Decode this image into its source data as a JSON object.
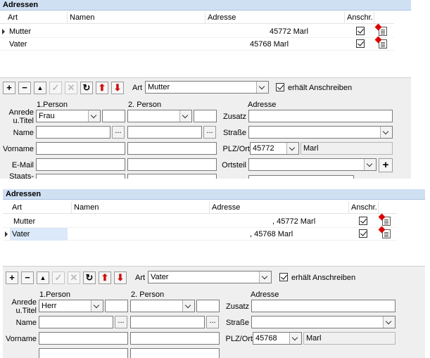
{
  "panel1": {
    "title": "Adressen",
    "columns": [
      "Art",
      "Namen",
      "Adresse",
      "Anschr."
    ],
    "rows": [
      {
        "art": "Mutter",
        "adresse": "45772 Marl"
      },
      {
        "art": "Vater",
        "adresse": "45768 Marl"
      }
    ],
    "form": {
      "art_label": "Art",
      "art_value": "Mutter",
      "checkbox_label": "erhält Anschreiben",
      "person1_header": "1.Person",
      "person2_header": "2. Person",
      "adresse_header": "Adresse",
      "anrede_label_1": "Anrede",
      "anrede_label_2": "u.Titel",
      "anrede_value": "Frau",
      "name_label": "Name",
      "vorname_label": "Vorname",
      "email_label": "E-Mail",
      "staats_label": "Staats-",
      "zusatz_label": "Zusatz",
      "strasse_label": "Straße",
      "plz_label": "PLZ/Ort",
      "plz_value": "45772",
      "ort_value": "Marl",
      "ortsteil_label": "Ortsteil",
      "ellipsis": "...",
      "plus": "+"
    }
  },
  "panel2": {
    "title": "Adressen",
    "columns": [
      "Art",
      "Namen",
      "Adresse",
      "Anschr."
    ],
    "rows": [
      {
        "art": "Mutter",
        "adresse": ", 45772 Marl"
      },
      {
        "art": "Vater",
        "adresse": ", 45768 Marl"
      }
    ],
    "form": {
      "art_label": "Art",
      "art_value": "Vater",
      "checkbox_label": "erhält Anschreiben",
      "person1_header": "1.Person",
      "person2_header": "2. Person",
      "adresse_header": "Adresse",
      "anrede_label_1": "Anrede",
      "anrede_label_2": "u.Titel",
      "anrede_value": "Herr",
      "name_label": "Name",
      "vorname_label": "Vorname",
      "zusatz_label": "Zusatz",
      "strasse_label": "Straße",
      "plz_label": "PLZ/Ort",
      "plz_value": "45768",
      "ort_value": "Marl",
      "ellipsis": "..."
    }
  },
  "toolbar_icons": [
    "add-icon",
    "remove-icon",
    "move-up-icon",
    "confirm-icon",
    "cancel-icon",
    "refresh-icon",
    "arrow-up-red-icon",
    "arrow-down-red-icon"
  ],
  "toolbar_glyphs": {
    "add": "+",
    "remove": "−",
    "up": "▲",
    "confirm": "✓",
    "cancel": "✕",
    "refresh": "↻",
    "red_up": "⬆",
    "red_down": "⬇"
  }
}
